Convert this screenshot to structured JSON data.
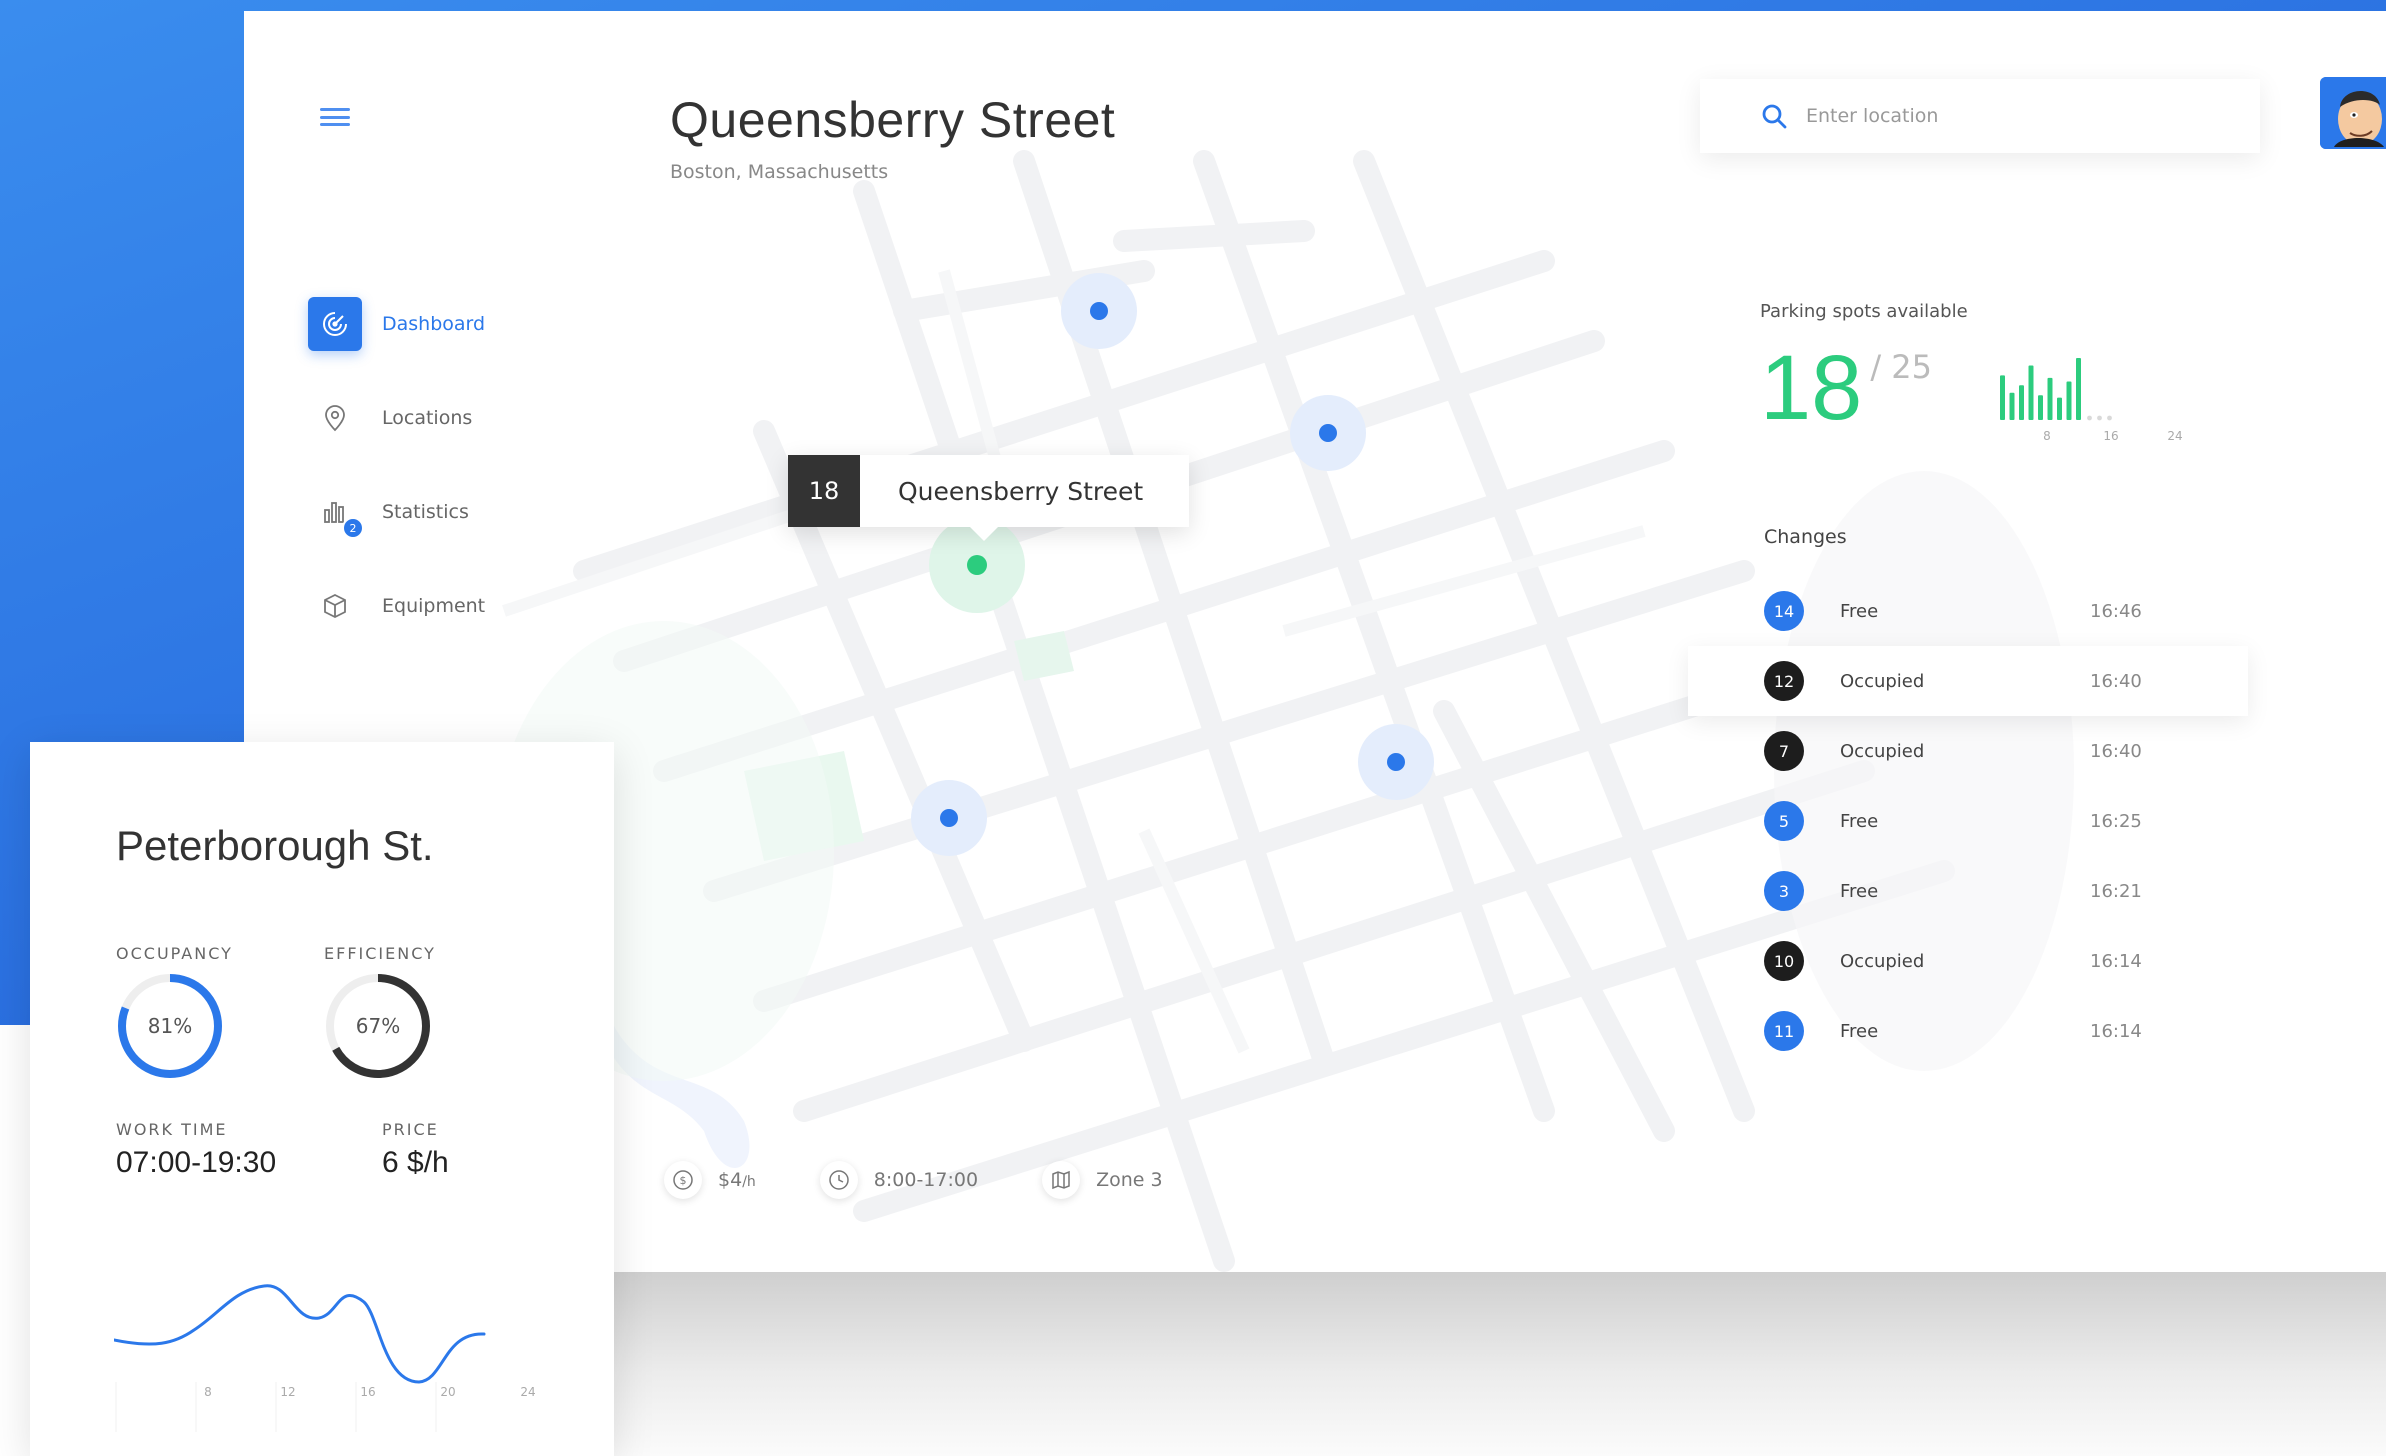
{
  "header": {
    "title": "Queensberry Street",
    "subtitle": "Boston, Massachusetts"
  },
  "search": {
    "placeholder": "Enter location"
  },
  "sidebar": {
    "items": [
      {
        "label": "Dashboard",
        "icon": "radar-icon",
        "active": true
      },
      {
        "label": "Locations",
        "icon": "location-pin-icon"
      },
      {
        "label": "Statistics",
        "icon": "bar-chart-icon",
        "badge": "2"
      },
      {
        "label": "Equipment",
        "icon": "cube-icon"
      }
    ]
  },
  "map": {
    "tooltip_number": "18",
    "tooltip_name": "Queensberry Street"
  },
  "footer": {
    "price": "$4",
    "price_unit": "/h",
    "hours": "8:00-17:00",
    "zone": "Zone 3"
  },
  "parking": {
    "label": "Parking spots available",
    "available": "18",
    "total": "/ 25",
    "ticks": [
      "8",
      "16",
      "24"
    ],
    "bars": [
      0.72,
      0.44,
      0.56,
      0.88,
      0.4,
      0.68,
      0.36,
      0.62,
      1.0
    ]
  },
  "changes": {
    "title": "Changes",
    "rows": [
      {
        "num": "14",
        "status": "Free",
        "time": "16:46",
        "type": "free"
      },
      {
        "num": "12",
        "status": "Occupied",
        "time": "16:40",
        "type": "occupied",
        "highlight": true
      },
      {
        "num": "7",
        "status": "Occupied",
        "time": "16:40",
        "type": "occupied"
      },
      {
        "num": "5",
        "status": "Free",
        "time": "16:25",
        "type": "free"
      },
      {
        "num": "3",
        "status": "Free",
        "time": "16:21",
        "type": "free"
      },
      {
        "num": "10",
        "status": "Occupied",
        "time": "16:14",
        "type": "occupied"
      },
      {
        "num": "11",
        "status": "Free",
        "time": "16:14",
        "type": "free"
      }
    ]
  },
  "card": {
    "title": "Peterborough St.",
    "occupancy_label": "OCCUPANCY",
    "occupancy_value": "81%",
    "occupancy": 0.81,
    "efficiency_label": "EFFICIENCY",
    "efficiency_value": "67%",
    "efficiency": 0.67,
    "work_time_label": "WORK TIME",
    "work_time_value": "07:00-19:30",
    "price_label": "PRICE",
    "price_value": "6 $/h",
    "chart_ticks": [
      "8",
      "12",
      "16",
      "20",
      "24"
    ]
  },
  "colors": {
    "accent": "#2b78ea",
    "green": "#2ccc7e",
    "dark": "#1d1d1d"
  }
}
